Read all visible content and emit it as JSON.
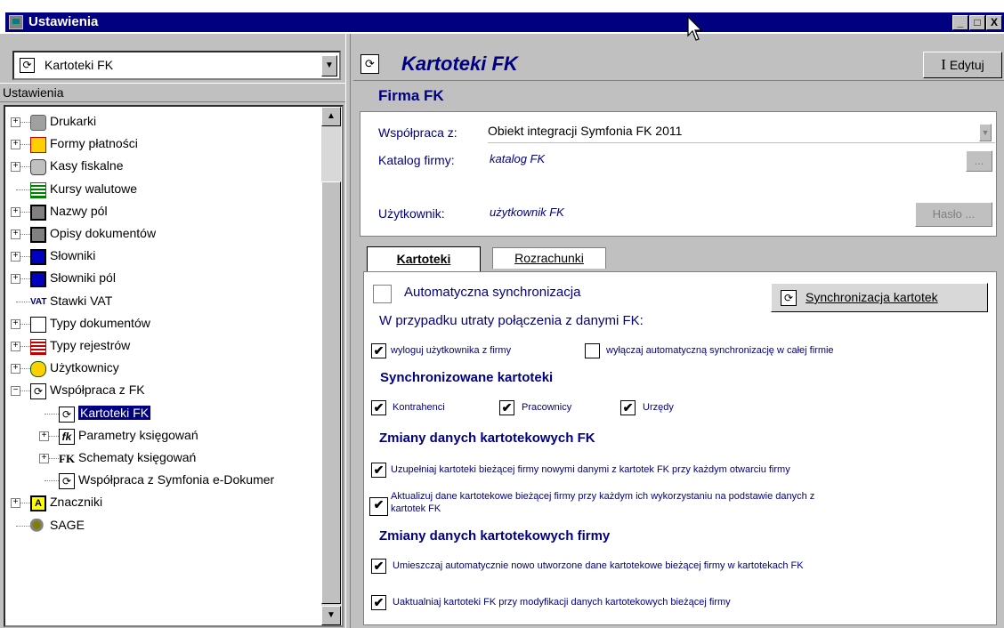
{
  "window": {
    "title": "Ustawienia",
    "buttons": {
      "minimize": "_",
      "maximize": "□",
      "close": "X"
    }
  },
  "left": {
    "combo_value": "Kartoteki FK",
    "tree_header": "Ustawienia",
    "tree": [
      {
        "label": "Drukarki",
        "icon": "printer-icon",
        "expander": "+"
      },
      {
        "label": "Formy płatności",
        "icon": "payment-icon",
        "expander": "+"
      },
      {
        "label": "Kasy fiskalne",
        "icon": "cash-register-icon",
        "expander": "+"
      },
      {
        "label": "Kursy walutowe",
        "icon": "exchange-rate-icon",
        "expander": ""
      },
      {
        "label": "Nazwy pól",
        "icon": "field-names-icon",
        "expander": "+"
      },
      {
        "label": "Opisy dokumentów",
        "icon": "document-desc-icon",
        "expander": "+"
      },
      {
        "label": "Słowniki",
        "icon": "dictionary-icon",
        "expander": "+"
      },
      {
        "label": "Słowniki pól",
        "icon": "field-dictionary-icon",
        "expander": "+"
      },
      {
        "label": "Stawki VAT",
        "icon": "vat-icon",
        "expander": "",
        "icon_text": "VAT"
      },
      {
        "label": "Typy dokumentów",
        "icon": "doc-types-icon",
        "expander": "+"
      },
      {
        "label": "Typy rejestrów",
        "icon": "register-types-icon",
        "expander": "+"
      },
      {
        "label": "Użytkownicy",
        "icon": "users-icon",
        "expander": "+"
      },
      {
        "label": "Współpraca z FK",
        "icon": "sync-icon",
        "expander": "−"
      },
      {
        "label": "Kartoteki FK",
        "icon": "sync-icon",
        "expander": "",
        "selected": true
      },
      {
        "label": "Parametry księgowań",
        "icon": "fk-params-icon",
        "expander": "+",
        "icon_text": "fk"
      },
      {
        "label": "Schematy księgowań",
        "icon": "fk-schemes-icon",
        "expander": "+",
        "icon_text": "FK"
      },
      {
        "label": "Współpraca z Symfonia e-Dokumer",
        "icon": "sync-icon",
        "expander": ""
      },
      {
        "label": "Znaczniki",
        "icon": "tags-icon",
        "expander": "+",
        "icon_text": "A"
      },
      {
        "label": "SAGE",
        "icon": "sage-icon",
        "expander": ""
      }
    ]
  },
  "right": {
    "title": "Kartoteki FK",
    "edit_label": "Edytuj",
    "firma_section": "Firma FK",
    "wspolpraca_label": "Współpraca z:",
    "wspolpraca_value": "Obiekt integracji Symfonia FK 2011",
    "katalog_label": "Katalog firmy:",
    "katalog_value": "katalog FK",
    "katalog_btn": "...",
    "uzytkownik_label": "Użytkownik:",
    "uzytkownik_value": "użytkownik FK",
    "haslo_btn": "Hasło ...",
    "tabs": [
      {
        "label": "Kartoteki",
        "active": true
      },
      {
        "label": "Rozrachunki",
        "active": false
      }
    ],
    "auto_sync_label": "Automatyczna synchronizacja",
    "auto_sync_checked": false,
    "sync_btn_label": "Synchronizacja kartotek",
    "lost_conn_label": "W przypadku utraty połączenia z danymi FK:",
    "logout_label": "wyloguj użytkownika z firmy",
    "logout_checked": true,
    "disable_sync_label": "wyłączaj automatyczną synchronizację w całej firmie",
    "disable_sync_checked": false,
    "sync_kartoteki_title": "Synchronizowane kartoteki",
    "kontrahenci_label": "Kontrahenci",
    "pracownicy_label": "Pracownicy",
    "urzedy_label": "Urzędy",
    "zmiany_fk_title": "Zmiany danych kartotekowych FK",
    "uzupelniaj_label": "Uzupełniaj kartoteki bieżącej firmy nowymi danymi z kartotek FK przy każdym otwarciu firmy",
    "aktualizuj_label_1": "Aktualizuj dane kartotekowe bieżącej firmy przy każdym ich wykorzystaniu na podstawie danych z",
    "aktualizuj_label_2": "kartotek FK",
    "zmiany_firmy_title": "Zmiany danych kartotekowych firmy",
    "umieszczaj_label": "Umieszczaj automatycznie nowo utworzone dane kartotekowe bieżącej firmy w kartotekach FK",
    "uaktualniaj_label": "Uaktualniaj kartoteki FK przy modyfikacji danych kartotekowych bieżącej firmy",
    "check_mark": "✔"
  }
}
